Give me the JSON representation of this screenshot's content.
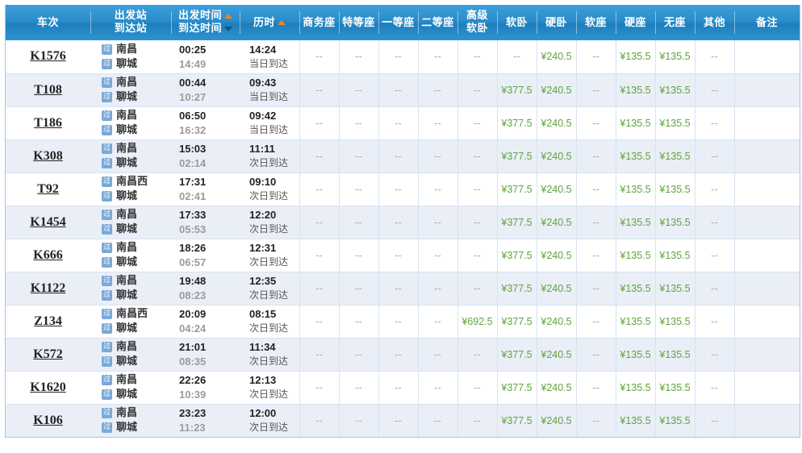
{
  "colors": {
    "header_blue": "#2a8cc9",
    "price_green": "#5fa33c",
    "row_even": "#eaeff7",
    "row_odd": "#ffffff",
    "sort_active_arrow": "#f08519",
    "sort_inactive_arrow": "#13537d",
    "grid_border": "#d7e3f0",
    "table_border": "#9ec7e8"
  },
  "header": {
    "train_code": "车次",
    "station_from": "出发站",
    "station_to": "到达站",
    "time_depart": "出发时间",
    "time_arrive": "到达时间",
    "duration": "历时",
    "business_seat": "商务座",
    "special_seat": "特等座",
    "first_seat": "一等座",
    "second_seat": "二等座",
    "premium_soft_sleeper_l1": "高级",
    "premium_soft_sleeper_l2": "软卧",
    "soft_sleeper": "软卧",
    "hard_sleeper": "硬卧",
    "soft_seat": "软座",
    "hard_seat": "硬座",
    "no_seat": "无座",
    "other": "其他",
    "remark": "备注",
    "sort_depart_icon": "sort-ascending-arrow-icon",
    "sort_arrive_icon": "sort-descending-arrow-icon",
    "sort_duration_icon": "sort-ascending-arrow-icon"
  },
  "common": {
    "pass_icon_label": "过",
    "dash": "--",
    "arrive_same_day": "当日到达",
    "arrive_next_day": "次日到达"
  },
  "rows": [
    {
      "code": "K1576",
      "from": "南昌",
      "to": "聊城",
      "depart": "00:25",
      "arrive": "14:49",
      "duration": "14:24",
      "day_note": "当日到达",
      "business": "--",
      "special": "--",
      "first": "--",
      "second": "--",
      "premium_soft": "--",
      "soft_sleeper": "--",
      "hard_sleeper": "¥240.5",
      "soft_seat": "--",
      "hard_seat": "¥135.5",
      "no_seat": "¥135.5",
      "other": "--",
      "remark": ""
    },
    {
      "code": "T108",
      "from": "南昌",
      "to": "聊城",
      "depart": "00:44",
      "arrive": "10:27",
      "duration": "09:43",
      "day_note": "当日到达",
      "business": "--",
      "special": "--",
      "first": "--",
      "second": "--",
      "premium_soft": "--",
      "soft_sleeper": "¥377.5",
      "hard_sleeper": "¥240.5",
      "soft_seat": "--",
      "hard_seat": "¥135.5",
      "no_seat": "¥135.5",
      "other": "--",
      "remark": ""
    },
    {
      "code": "T186",
      "from": "南昌",
      "to": "聊城",
      "depart": "06:50",
      "arrive": "16:32",
      "duration": "09:42",
      "day_note": "当日到达",
      "business": "--",
      "special": "--",
      "first": "--",
      "second": "--",
      "premium_soft": "--",
      "soft_sleeper": "¥377.5",
      "hard_sleeper": "¥240.5",
      "soft_seat": "--",
      "hard_seat": "¥135.5",
      "no_seat": "¥135.5",
      "other": "--",
      "remark": ""
    },
    {
      "code": "K308",
      "from": "南昌",
      "to": "聊城",
      "depart": "15:03",
      "arrive": "02:14",
      "duration": "11:11",
      "day_note": "次日到达",
      "business": "--",
      "special": "--",
      "first": "--",
      "second": "--",
      "premium_soft": "--",
      "soft_sleeper": "¥377.5",
      "hard_sleeper": "¥240.5",
      "soft_seat": "--",
      "hard_seat": "¥135.5",
      "no_seat": "¥135.5",
      "other": "--",
      "remark": ""
    },
    {
      "code": "T92",
      "from": "南昌西",
      "to": "聊城",
      "depart": "17:31",
      "arrive": "02:41",
      "duration": "09:10",
      "day_note": "次日到达",
      "business": "--",
      "special": "--",
      "first": "--",
      "second": "--",
      "premium_soft": "--",
      "soft_sleeper": "¥377.5",
      "hard_sleeper": "¥240.5",
      "soft_seat": "--",
      "hard_seat": "¥135.5",
      "no_seat": "¥135.5",
      "other": "--",
      "remark": ""
    },
    {
      "code": "K1454",
      "from": "南昌",
      "to": "聊城",
      "depart": "17:33",
      "arrive": "05:53",
      "duration": "12:20",
      "day_note": "次日到达",
      "business": "--",
      "special": "--",
      "first": "--",
      "second": "--",
      "premium_soft": "--",
      "soft_sleeper": "¥377.5",
      "hard_sleeper": "¥240.5",
      "soft_seat": "--",
      "hard_seat": "¥135.5",
      "no_seat": "¥135.5",
      "other": "--",
      "remark": ""
    },
    {
      "code": "K666",
      "from": "南昌",
      "to": "聊城",
      "depart": "18:26",
      "arrive": "06:57",
      "duration": "12:31",
      "day_note": "次日到达",
      "business": "--",
      "special": "--",
      "first": "--",
      "second": "--",
      "premium_soft": "--",
      "soft_sleeper": "¥377.5",
      "hard_sleeper": "¥240.5",
      "soft_seat": "--",
      "hard_seat": "¥135.5",
      "no_seat": "¥135.5",
      "other": "--",
      "remark": ""
    },
    {
      "code": "K1122",
      "from": "南昌",
      "to": "聊城",
      "depart": "19:48",
      "arrive": "08:23",
      "duration": "12:35",
      "day_note": "次日到达",
      "business": "--",
      "special": "--",
      "first": "--",
      "second": "--",
      "premium_soft": "--",
      "soft_sleeper": "¥377.5",
      "hard_sleeper": "¥240.5",
      "soft_seat": "--",
      "hard_seat": "¥135.5",
      "no_seat": "¥135.5",
      "other": "--",
      "remark": ""
    },
    {
      "code": "Z134",
      "from": "南昌西",
      "to": "聊城",
      "depart": "20:09",
      "arrive": "04:24",
      "duration": "08:15",
      "day_note": "次日到达",
      "business": "--",
      "special": "--",
      "first": "--",
      "second": "--",
      "premium_soft": "¥692.5",
      "soft_sleeper": "¥377.5",
      "hard_sleeper": "¥240.5",
      "soft_seat": "--",
      "hard_seat": "¥135.5",
      "no_seat": "¥135.5",
      "other": "--",
      "remark": ""
    },
    {
      "code": "K572",
      "from": "南昌",
      "to": "聊城",
      "depart": "21:01",
      "arrive": "08:35",
      "duration": "11:34",
      "day_note": "次日到达",
      "business": "--",
      "special": "--",
      "first": "--",
      "second": "--",
      "premium_soft": "--",
      "soft_sleeper": "¥377.5",
      "hard_sleeper": "¥240.5",
      "soft_seat": "--",
      "hard_seat": "¥135.5",
      "no_seat": "¥135.5",
      "other": "--",
      "remark": ""
    },
    {
      "code": "K1620",
      "from": "南昌",
      "to": "聊城",
      "depart": "22:26",
      "arrive": "10:39",
      "duration": "12:13",
      "day_note": "次日到达",
      "business": "--",
      "special": "--",
      "first": "--",
      "second": "--",
      "premium_soft": "--",
      "soft_sleeper": "¥377.5",
      "hard_sleeper": "¥240.5",
      "soft_seat": "--",
      "hard_seat": "¥135.5",
      "no_seat": "¥135.5",
      "other": "--",
      "remark": ""
    },
    {
      "code": "K106",
      "from": "南昌",
      "to": "聊城",
      "depart": "23:23",
      "arrive": "11:23",
      "duration": "12:00",
      "day_note": "次日到达",
      "business": "--",
      "special": "--",
      "first": "--",
      "second": "--",
      "premium_soft": "--",
      "soft_sleeper": "¥377.5",
      "hard_sleeper": "¥240.5",
      "soft_seat": "--",
      "hard_seat": "¥135.5",
      "no_seat": "¥135.5",
      "other": "--",
      "remark": ""
    }
  ]
}
